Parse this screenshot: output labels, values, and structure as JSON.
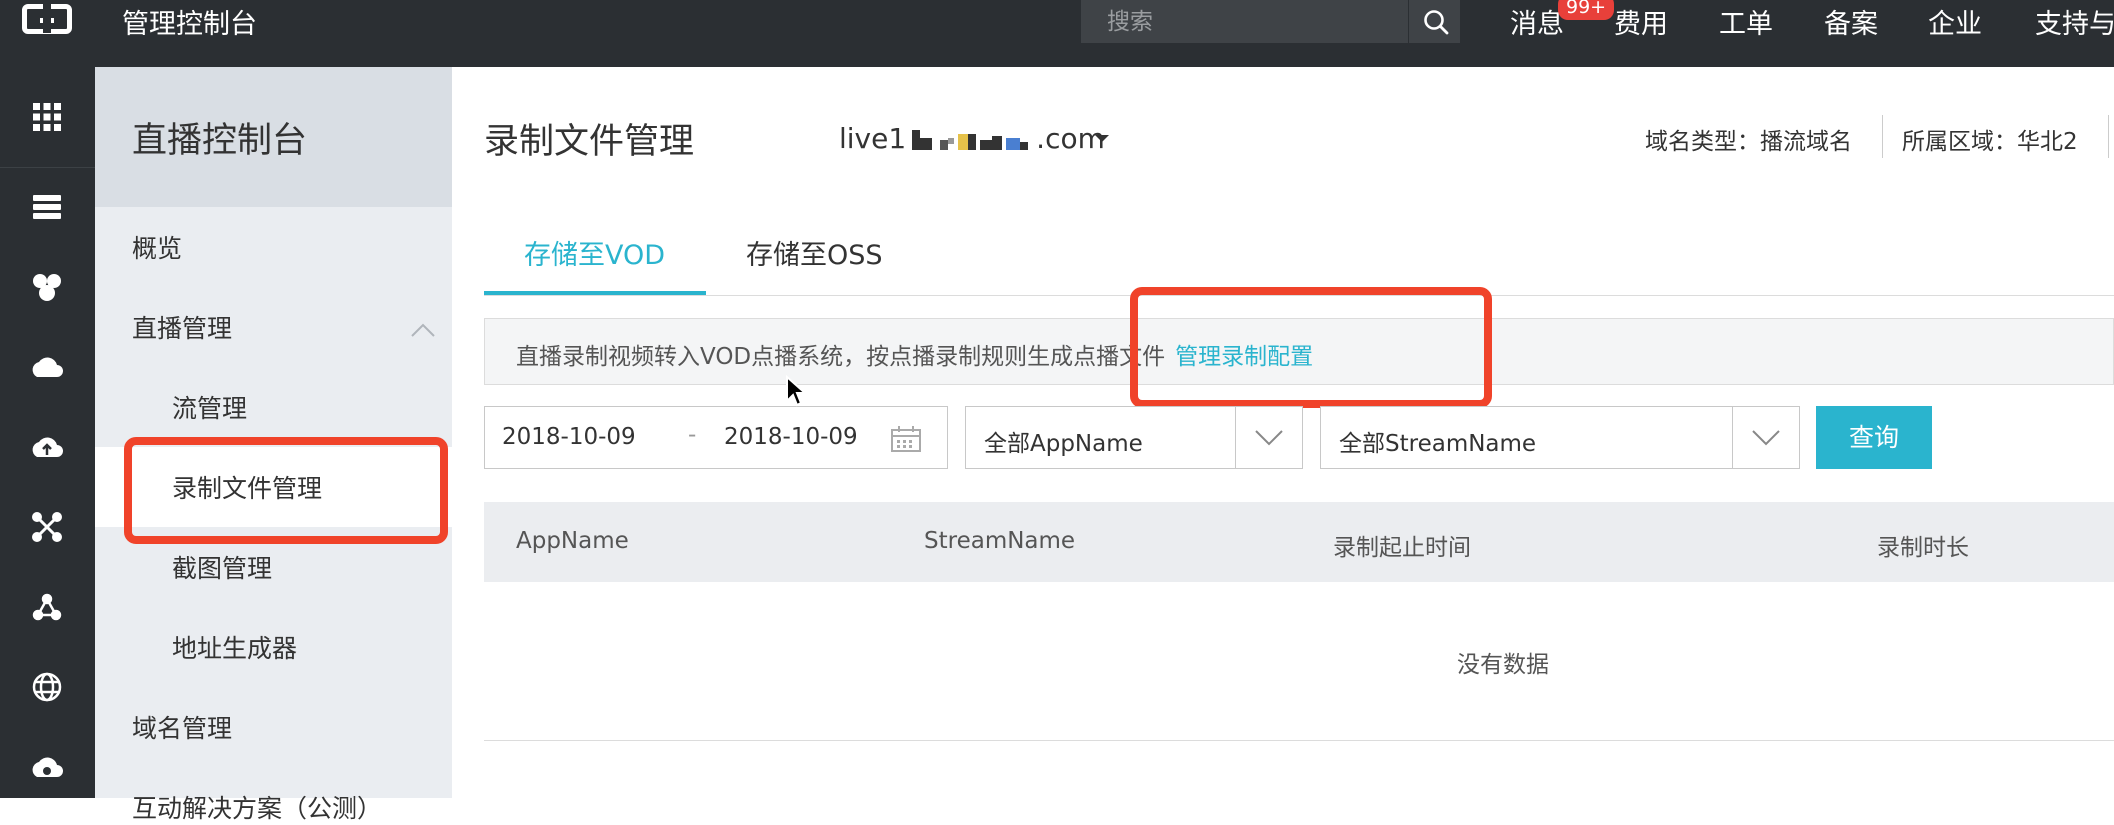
{
  "topbar": {
    "logo": "aliyun-logo",
    "title": "管理控制台",
    "search": {
      "placeholder": "搜索"
    },
    "nav": {
      "messages": "消息",
      "badge": "99+",
      "billing": "费用",
      "tickets": "工单",
      "icp": "备案",
      "enterprise": "企业",
      "support": "支持与"
    }
  },
  "iconbar": {
    "icons": [
      "apps-grid-icon",
      "server-icon",
      "cluster-icon",
      "cloud-icon",
      "cloud-upload-icon",
      "network-icon",
      "share-icon",
      "globe-icon",
      "cloud-gear-icon"
    ]
  },
  "sidebar": {
    "title": "直播控制台",
    "items": {
      "overview": "概览",
      "live_mgmt": "直播管理",
      "stream_mgmt": "流管理",
      "record_mgmt": "录制文件管理",
      "snapshot_mgmt": "截图管理",
      "url_gen": "地址生成器",
      "domain_mgmt": "域名管理",
      "partial": "互动解决方案（公测）"
    }
  },
  "main": {
    "title": "录制文件管理",
    "domain_prefix": "live1",
    "domain_suffix": ".com",
    "domain_type": "域名类型：播流域名",
    "region": "所属区域：华北2",
    "tabs": {
      "vod": "存储至VOD",
      "oss": "存储至OSS"
    },
    "notice": {
      "text": "直播录制视频转入VOD点播系统，按点播录制规则生成点播文件",
      "link": "管理录制配置"
    },
    "filters": {
      "date_start": "2018-10-09",
      "date_sep": "-",
      "date_end": "2018-10-09",
      "app_select": "全部AppName",
      "stream_select": "全部StreamName",
      "query": "查询"
    },
    "table": {
      "headers": {
        "app": "AppName",
        "stream": "StreamName",
        "time": "录制起止时间",
        "duration": "录制时长"
      },
      "empty": "没有数据"
    }
  },
  "colors": {
    "accent": "#2ab4ce",
    "topbar": "#2b2f33",
    "highlight": "#f0432a",
    "badge": "#e8403a"
  }
}
